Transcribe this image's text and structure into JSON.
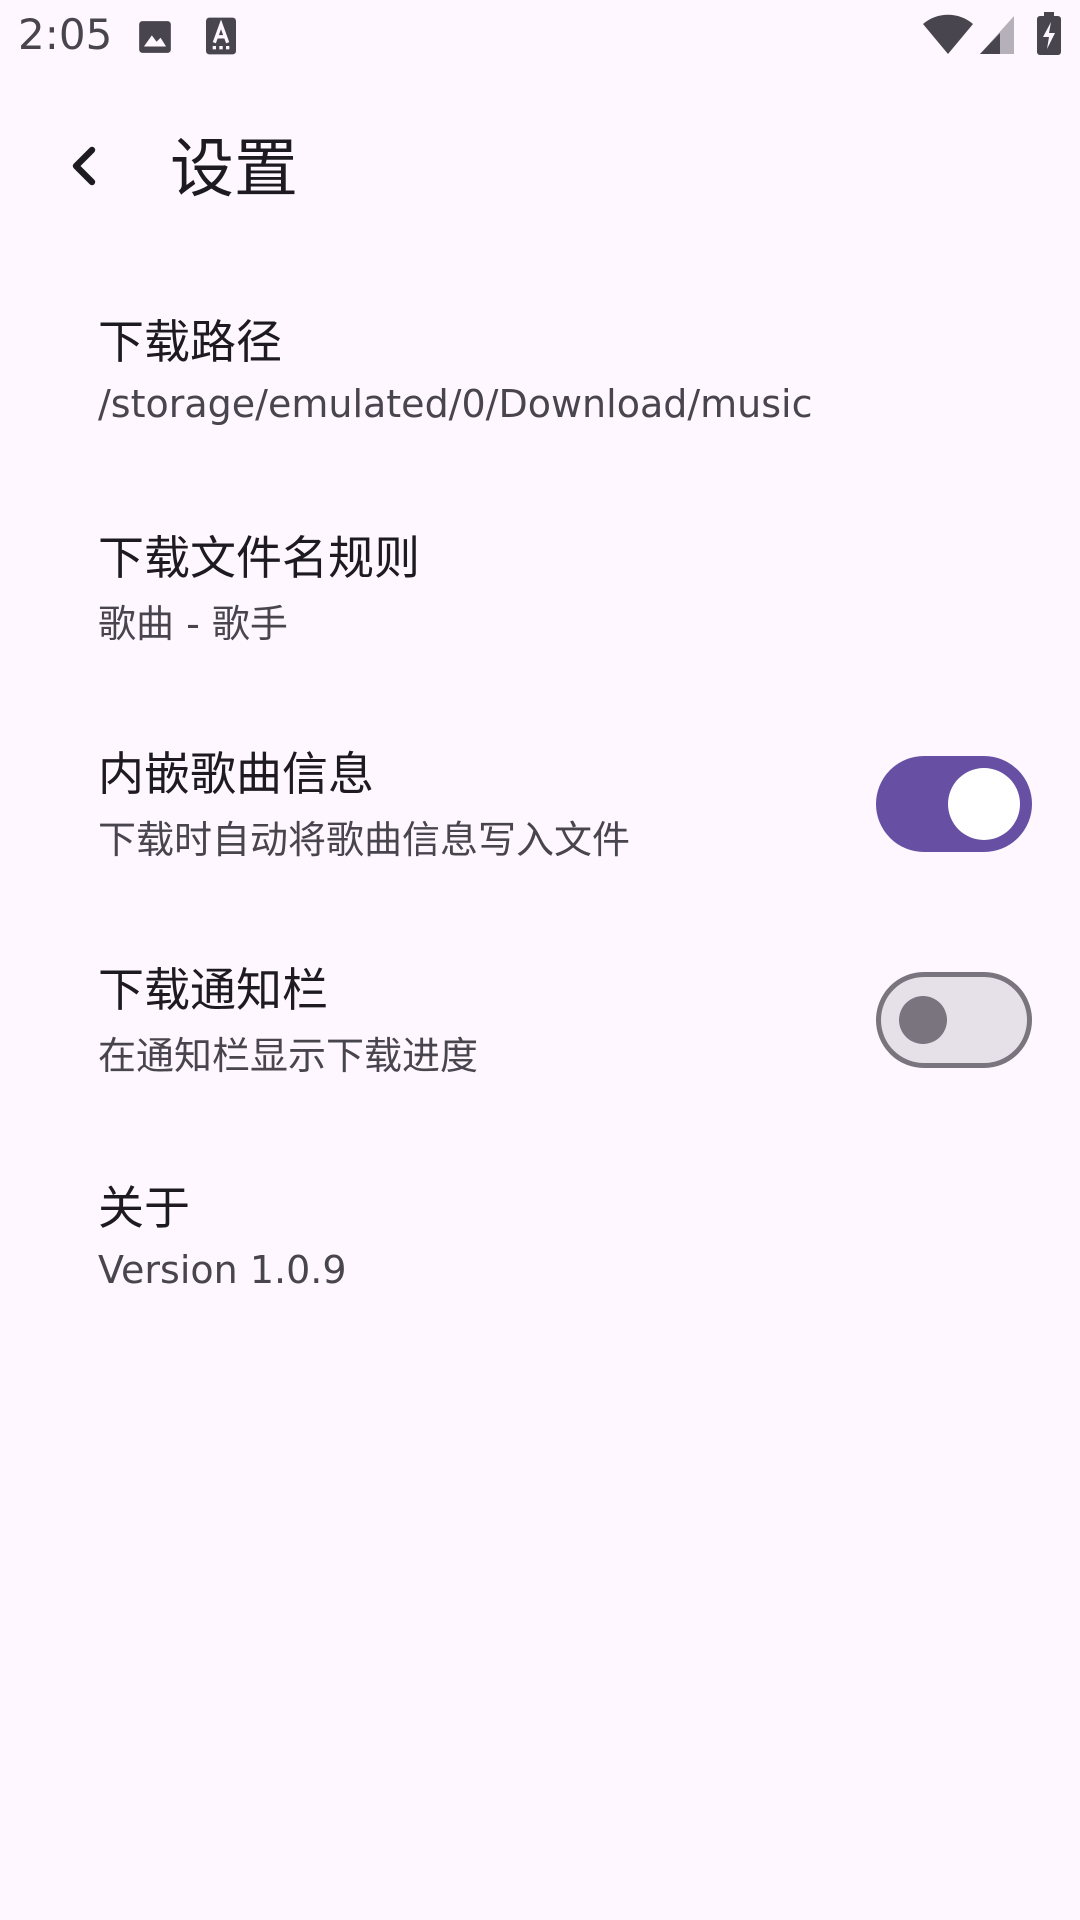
{
  "status_bar": {
    "time": "2:05",
    "icons": [
      "image-icon",
      "a-accessibility-icon",
      "wifi-icon",
      "cell-signal-icon",
      "battery-charging-icon"
    ]
  },
  "top_bar": {
    "back_icon": "chevron-left-icon",
    "title": "设置"
  },
  "settings": {
    "items": [
      {
        "title": "下载路径",
        "subtitle": "/storage/emulated/0/Download/music"
      },
      {
        "title": "下载文件名规则",
        "subtitle": "歌曲 - 歌手"
      },
      {
        "title": "内嵌歌曲信息",
        "subtitle": "下载时自动将歌曲信息写入文件",
        "switch_on": true
      },
      {
        "title": "下载通知栏",
        "subtitle": "在通知栏显示下载进度",
        "switch_on": false
      },
      {
        "title": "关于",
        "subtitle": "Version 1.0.9"
      }
    ]
  },
  "colors": {
    "background": "#FEF7FF",
    "primary": "#6750A4",
    "on_surface": "#1D1B20",
    "on_surface_variant": "#49454F",
    "outline": "#79747E",
    "surface_container_highest": "#E6E0E9"
  }
}
